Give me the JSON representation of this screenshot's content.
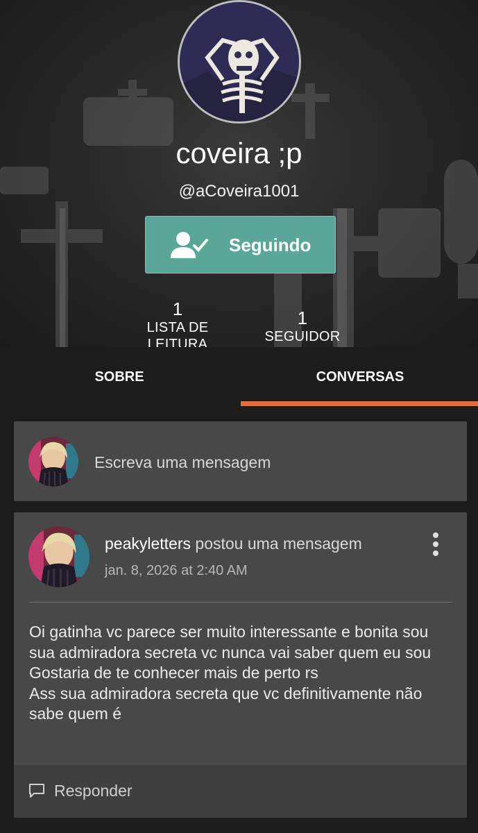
{
  "profile": {
    "display_name": "coveira ;p",
    "handle": "@aCoveira1001",
    "follow_button_label": "Seguindo",
    "stats": {
      "reading_lists_count": "1",
      "reading_lists_label": "LISTA DE LEITURA",
      "followers_count": "1",
      "followers_label": "SEGUIDOR"
    }
  },
  "tabs": [
    {
      "label": "SOBRE",
      "active": false
    },
    {
      "label": "CONVERSAS",
      "active": true
    }
  ],
  "compose": {
    "placeholder": "Escreva uma mensagem"
  },
  "post": {
    "author": "peakyletters",
    "action": " postou uma mensagem",
    "timestamp": "jan. 8, 2026 at 2:40 AM",
    "body": "Oi gatinha vc parece ser muito interessante e bonita sou sua admiradora secreta vc nunca vai saber quem eu sou\nGostaria de te conhecer mais de perto rs\nAss sua admiradora secreta que vc definitivamente não sabe quem é",
    "reply_label": "Responder"
  },
  "colors": {
    "accent_tab": "#e2703f",
    "follow_button": "#5aa79a",
    "card": "#484848",
    "background": "#1c1c1c"
  },
  "icons": [
    "skeleton-avatar-icon",
    "user-check-icon",
    "more-vertical-icon",
    "comment-icon"
  ]
}
